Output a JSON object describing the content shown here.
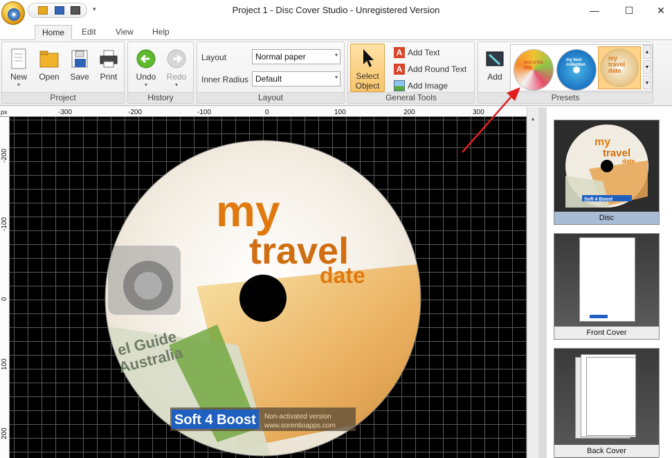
{
  "window": {
    "title": "Project 1 - Disc Cover Studio - Unregistered Version",
    "minimize": "—",
    "maximize": "☐",
    "close": "✕"
  },
  "qat_drop": "▾",
  "tabs": [
    {
      "label": "Home"
    },
    {
      "label": "Edit"
    },
    {
      "label": "View"
    },
    {
      "label": "Help"
    }
  ],
  "ribbon": {
    "project": {
      "label": "Project",
      "new": "New",
      "open": "Open",
      "save": "Save",
      "print": "Print",
      "caret": "▾"
    },
    "history": {
      "label": "History",
      "undo": "Undo",
      "redo": "Redo"
    },
    "layout": {
      "label": "Layout",
      "layout_label": "Layout",
      "layout_value": "Normal paper",
      "radius_label": "Inner Radius",
      "radius_value": "Default"
    },
    "tools": {
      "label": "General Tools",
      "select_line1": "Select",
      "select_line2": "Object",
      "add_text": "Add Text",
      "add_round_text": "Add Round Text",
      "add_image": "Add Image"
    },
    "presets": {
      "label": "Presets",
      "add": "Add",
      "up": "▲",
      "down": "▼",
      "more": "▾"
    }
  },
  "ruler": {
    "unit": "px",
    "h_ticks": [
      "-300",
      "-200",
      "-100",
      "0",
      "100",
      "200",
      "300"
    ],
    "v_ticks": [
      "-200",
      "-100",
      "0",
      "100",
      "200"
    ]
  },
  "disc_art": {
    "line1": "my",
    "line2": "travel",
    "line3": "date",
    "guide1": "el Guide",
    "guide2": "Australia",
    "logo": "Soft 4 Boost",
    "notice1": "Non-activated version",
    "notice2": "www.sorentioapps.com"
  },
  "preset_thumbs": [
    {
      "text": "best of the year"
    },
    {
      "text": "my best collection"
    },
    {
      "text": "my travel date"
    }
  ],
  "panel": {
    "disc": "Disc",
    "front_cover": "Front Cover",
    "back_cover": "Back Cover",
    "disc_thumb_line1": "my",
    "disc_thumb_line2": "travel",
    "disc_thumb_line3": "date",
    "disc_thumb_logo": "Soft 4 Boost"
  },
  "colors": {
    "accent_orange": "#e07a10",
    "selected_blue": "#a9bcd6",
    "canvas_bg": "#000000",
    "arrow_red": "#e02020"
  }
}
